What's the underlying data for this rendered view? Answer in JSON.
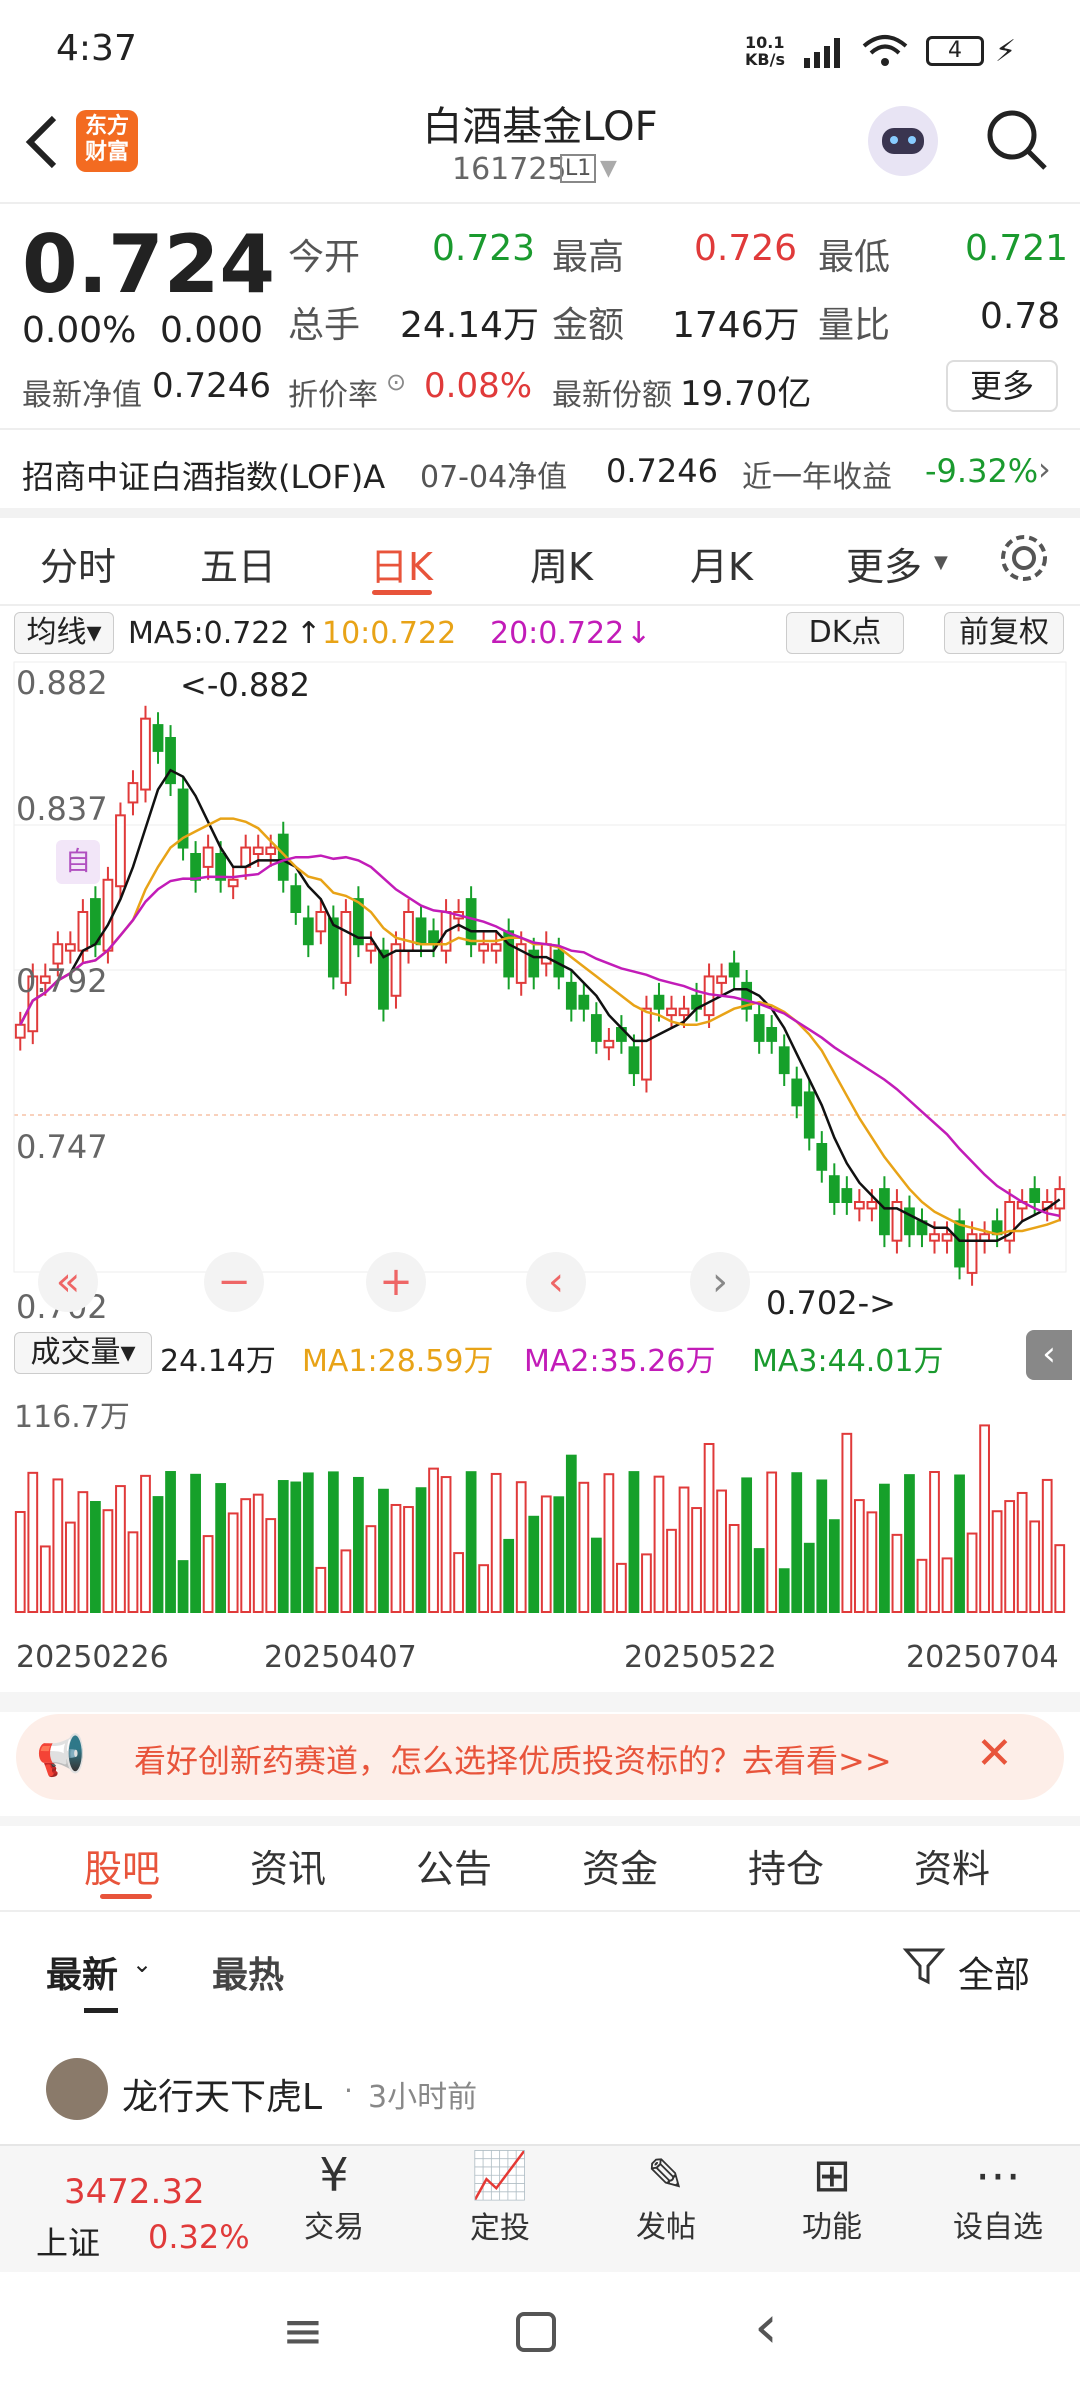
{
  "status": {
    "time": "4:37",
    "net": "10.1 KB/s",
    "battery": "4"
  },
  "header": {
    "logo": "东方财富",
    "title": "白酒基金LOF",
    "code": "161725",
    "level": "L1"
  },
  "quote": {
    "price": "0.724",
    "change_pct": "0.00%",
    "change": "0.000",
    "open_label": "今开",
    "open": "0.723",
    "high_label": "最高",
    "high": "0.726",
    "low_label": "最低",
    "low": "0.721",
    "vol_label": "总手",
    "vol": "24.14万",
    "amt_label": "金额",
    "amt": "1746万",
    "ratio_label": "量比",
    "ratio": "0.78",
    "nav_label": "最新净值",
    "nav": "0.7246",
    "disc_label": "折价率",
    "disc": "0.08%",
    "share_label": "最新份额",
    "share": "19.70亿",
    "more": "更多"
  },
  "fund": {
    "name": "招商中证白酒指数(LOF)A",
    "date": "07-04净值",
    "nav": "0.7246",
    "ret_label": "近一年收益",
    "ret": "-9.32%"
  },
  "tabs": [
    "分时",
    "五日",
    "日K",
    "周K",
    "月K",
    "更多"
  ],
  "ma": {
    "sel": "均线",
    "ma5": "MA5:0.722",
    "ma10": "10:0.722",
    "ma20": "20:0.722",
    "dk": "DK点",
    "fq": "前复权"
  },
  "chart_data": {
    "type": "candlestick",
    "price_ticks": [
      "0.882",
      "0.837",
      "0.792",
      "0.747",
      "0.702"
    ],
    "max_label": "<-0.882",
    "min_label": "0.702->",
    "vol_ticks": [
      "116.7万"
    ],
    "dates": [
      "20250226",
      "20250407",
      "20250522",
      "20250704"
    ],
    "vol_legend": {
      "sel": "成交量",
      "cur": "24.14万",
      "ma1": "MA1:28.59万",
      "ma2": "MA2:35.26万",
      "ma3": "MA3:44.01万"
    },
    "closes": [
      0.775,
      0.79,
      0.79,
      0.8,
      0.8,
      0.81,
      0.8,
      0.82,
      0.84,
      0.85,
      0.87,
      0.86,
      0.85,
      0.83,
      0.82,
      0.83,
      0.82,
      0.82,
      0.83,
      0.83,
      0.83,
      0.82,
      0.81,
      0.8,
      0.81,
      0.79,
      0.81,
      0.8,
      0.8,
      0.78,
      0.8,
      0.81,
      0.8,
      0.8,
      0.81,
      0.81,
      0.8,
      0.8,
      0.8,
      0.79,
      0.8,
      0.79,
      0.8,
      0.79,
      0.78,
      0.78,
      0.77,
      0.77,
      0.77,
      0.76,
      0.78,
      0.78,
      0.78,
      0.78,
      0.78,
      0.79,
      0.79,
      0.79,
      0.78,
      0.77,
      0.77,
      0.76,
      0.75,
      0.74,
      0.73,
      0.72,
      0.72,
      0.72,
      0.72,
      0.71,
      0.72,
      0.71,
      0.71,
      0.71,
      0.71,
      0.7,
      0.71,
      0.71,
      0.71,
      0.72,
      0.72,
      0.72,
      0.72,
      0.724
    ]
  },
  "banner": {
    "text": "看好创新药赛道，怎么选择优质投资标的？去看看>>"
  },
  "subtabs": [
    "股吧",
    "资讯",
    "公告",
    "资金",
    "持仓",
    "资料"
  ],
  "feed": {
    "latest": "最新",
    "hot": "最热",
    "filter": "全部",
    "user": "龙行天下虎L",
    "time": "3小时前"
  },
  "index": {
    "value": "3472.32",
    "name": "上证",
    "pct": "0.32%"
  },
  "nav": [
    "交易",
    "定投",
    "发帖",
    "功能",
    "设自选"
  ]
}
